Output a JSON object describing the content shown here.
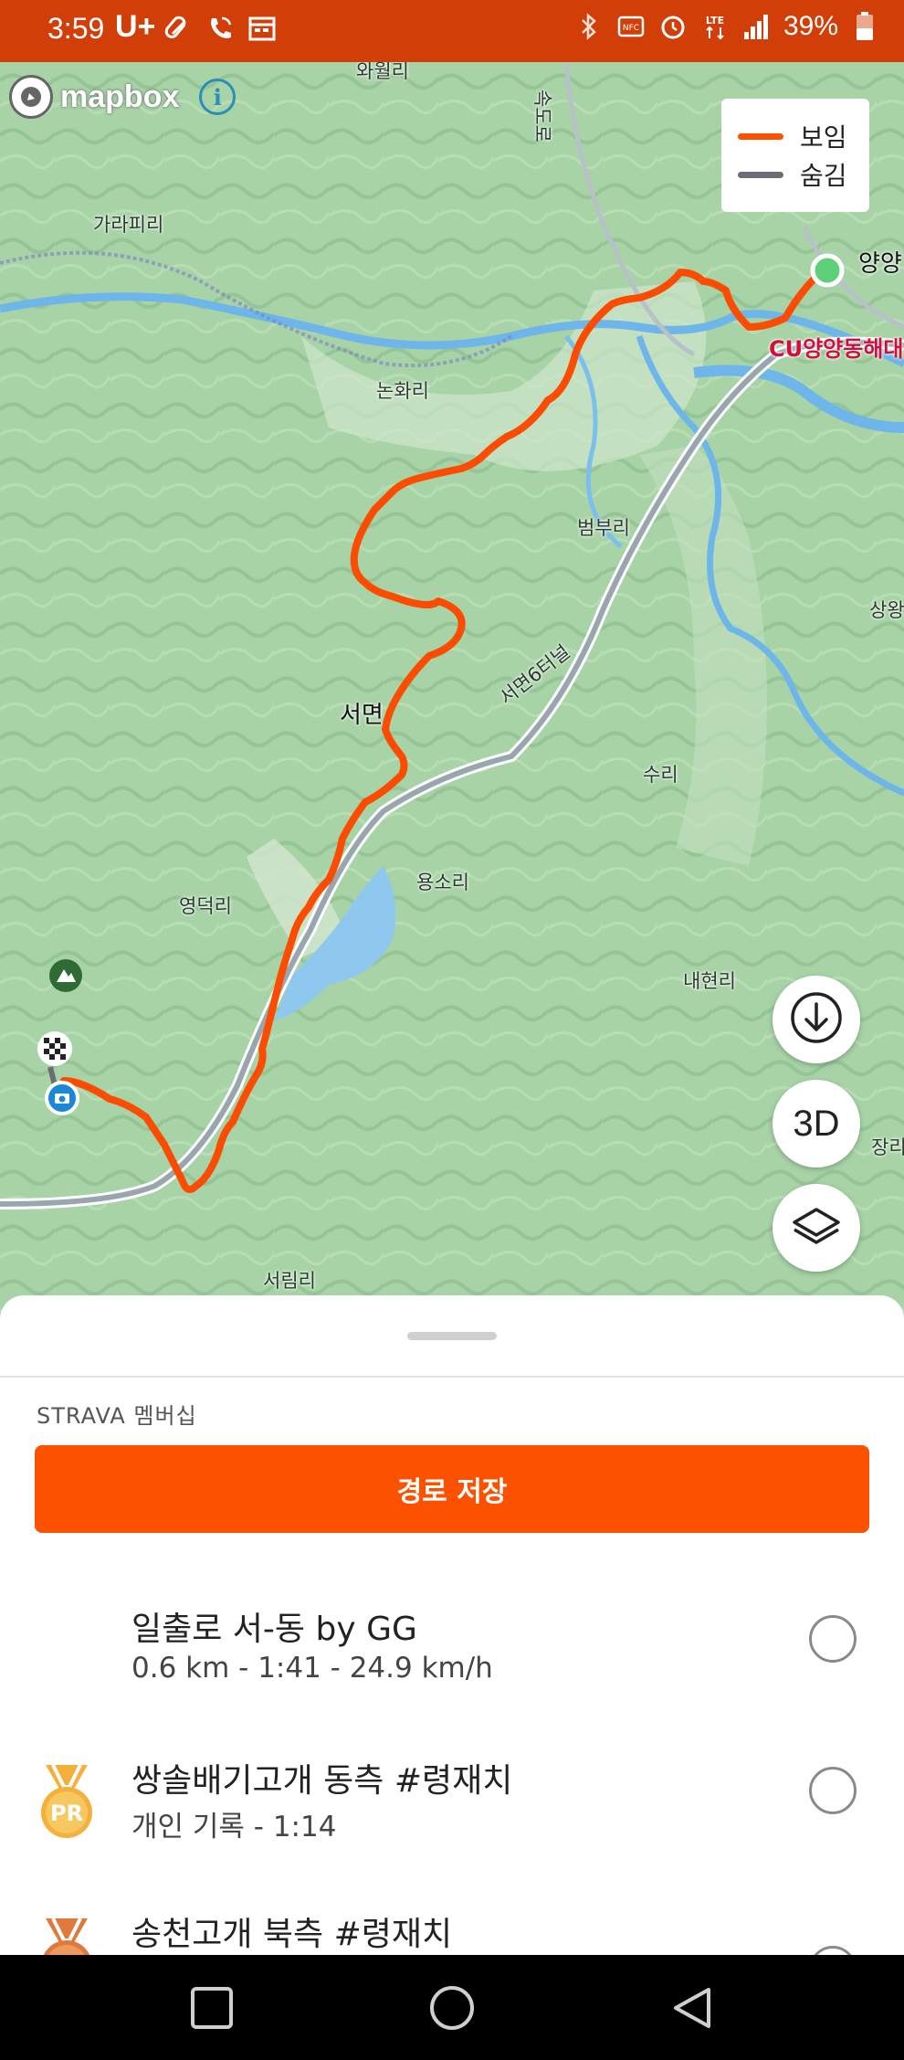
{
  "status_bar": {
    "time": "3:59",
    "carrier": "U+",
    "battery": "39%",
    "icons_left": [
      "pill-icon",
      "wifi-call-icon",
      "calendar-icon"
    ],
    "icons_right": [
      "bluetooth-icon",
      "nfc-icon",
      "alarm-icon",
      "lte-icon",
      "signal-icon",
      "battery-icon"
    ]
  },
  "map": {
    "attribution": "mapbox",
    "legend": [
      {
        "label": "보임",
        "color": "#fc5200"
      },
      {
        "label": "숨김",
        "color": "#6b6d76"
      }
    ],
    "places": {
      "p1": "와월리",
      "p2": "속도로",
      "p3": "가라피리",
      "p4": "양양",
      "p5": "CU양양동해대",
      "p6": "논화리",
      "p7": "범부리",
      "p8": "상왕",
      "p9": "서면6터널",
      "p10": "서면",
      "p11": "수리",
      "p12": "용소리",
      "p13": "영덕리",
      "p14": "내현리",
      "p15": "장리",
      "p16": "서림리"
    },
    "buttons": {
      "download_icon": "download-icon",
      "three_d_label": "3D",
      "layers_icon": "layers-icon"
    },
    "route_color": "#fc4c02"
  },
  "sheet": {
    "membership_label": "STRAVA 멤버십",
    "save_route_label": "경로 저장",
    "segments": [
      {
        "title": "일출로 서-동 by GG",
        "subtitle": "0.6 km - 1:41 - 24.9 km/h",
        "medal": ""
      },
      {
        "title": "쌍솔배기고개 동측 #령재치",
        "subtitle": "개인 기록 - 1:14",
        "medal": "PR"
      },
      {
        "title": "송천고개 북측 #령재치",
        "subtitle": "",
        "medal": "bronze"
      }
    ]
  },
  "nav_bar": [
    "recent-apps-button",
    "home-button",
    "back-button"
  ]
}
